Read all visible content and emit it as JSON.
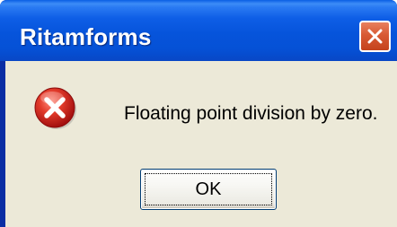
{
  "dialog": {
    "title": "Ritamforms",
    "message": "Floating point division by zero.",
    "ok_label": "OK",
    "icon": "error-icon",
    "close_icon": "close-icon"
  },
  "colors": {
    "titlebar": "#0654db",
    "client_bg": "#ece9d8",
    "close_button": "#d85a34",
    "error_red": "#d21f1f"
  }
}
